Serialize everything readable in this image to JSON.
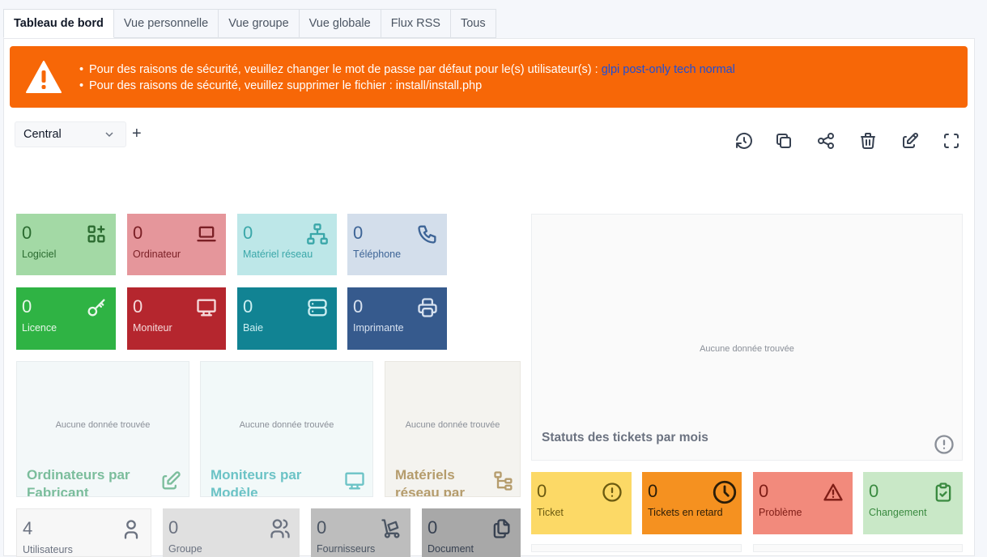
{
  "tabs": [
    "Tableau de bord",
    "Vue personnelle",
    "Vue groupe",
    "Vue globale",
    "Flux RSS",
    "Tous"
  ],
  "alert": {
    "line1_prefix": "Pour des raisons de sécurité, veuillez changer le mot de passe par défaut pour le(s) utilisateur(s) : ",
    "line1_users": "glpi post-only tech normal",
    "line2": "Pour des raisons de sécurité, veuillez supprimer le fichier : install/install.php"
  },
  "dashboard": {
    "selected": "Central",
    "add_label": "+"
  },
  "toolbar": [
    "history-icon",
    "copy-icon",
    "share-icon",
    "trash-icon",
    "edit-icon",
    "fullscreen-icon"
  ],
  "counters": {
    "logiciel": {
      "value": "0",
      "label": "Logiciel"
    },
    "ordinateur": {
      "value": "0",
      "label": "Ordinateur"
    },
    "materiel_reseau": {
      "value": "0",
      "label": "Matériel réseau"
    },
    "telephone": {
      "value": "0",
      "label": "Téléphone"
    },
    "licence": {
      "value": "0",
      "label": "Licence"
    },
    "moniteur": {
      "value": "0",
      "label": "Moniteur"
    },
    "baie": {
      "value": "0",
      "label": "Baie"
    },
    "imprimante": {
      "value": "0",
      "label": "Imprimante"
    },
    "ticket": {
      "value": "0",
      "label": "Ticket"
    },
    "tickets_retard": {
      "value": "0",
      "label": "Tickets en retard"
    },
    "probleme": {
      "value": "0",
      "label": "Problème"
    },
    "changement": {
      "value": "0",
      "label": "Changement"
    },
    "utilisateurs": {
      "value": "4",
      "label": "Utilisateurs"
    },
    "groupes": {
      "value": "0",
      "label": "Groupe"
    },
    "fournisseurs": {
      "value": "0",
      "label": "Fournisseurs"
    },
    "documents": {
      "value": "0",
      "label": "Document"
    }
  },
  "widgets": {
    "nodata": "Aucune donnée trouvée",
    "ordinateurs_fabricant": "Ordinateurs par Fabricant",
    "moniteurs_modele": "Moniteurs par Modèle",
    "materiels_reseau": "Matériels réseau par",
    "statuts_tickets": "Statuts des tickets par mois"
  },
  "colors": {
    "alert": "#f76707",
    "link": "#1d4ed8"
  }
}
